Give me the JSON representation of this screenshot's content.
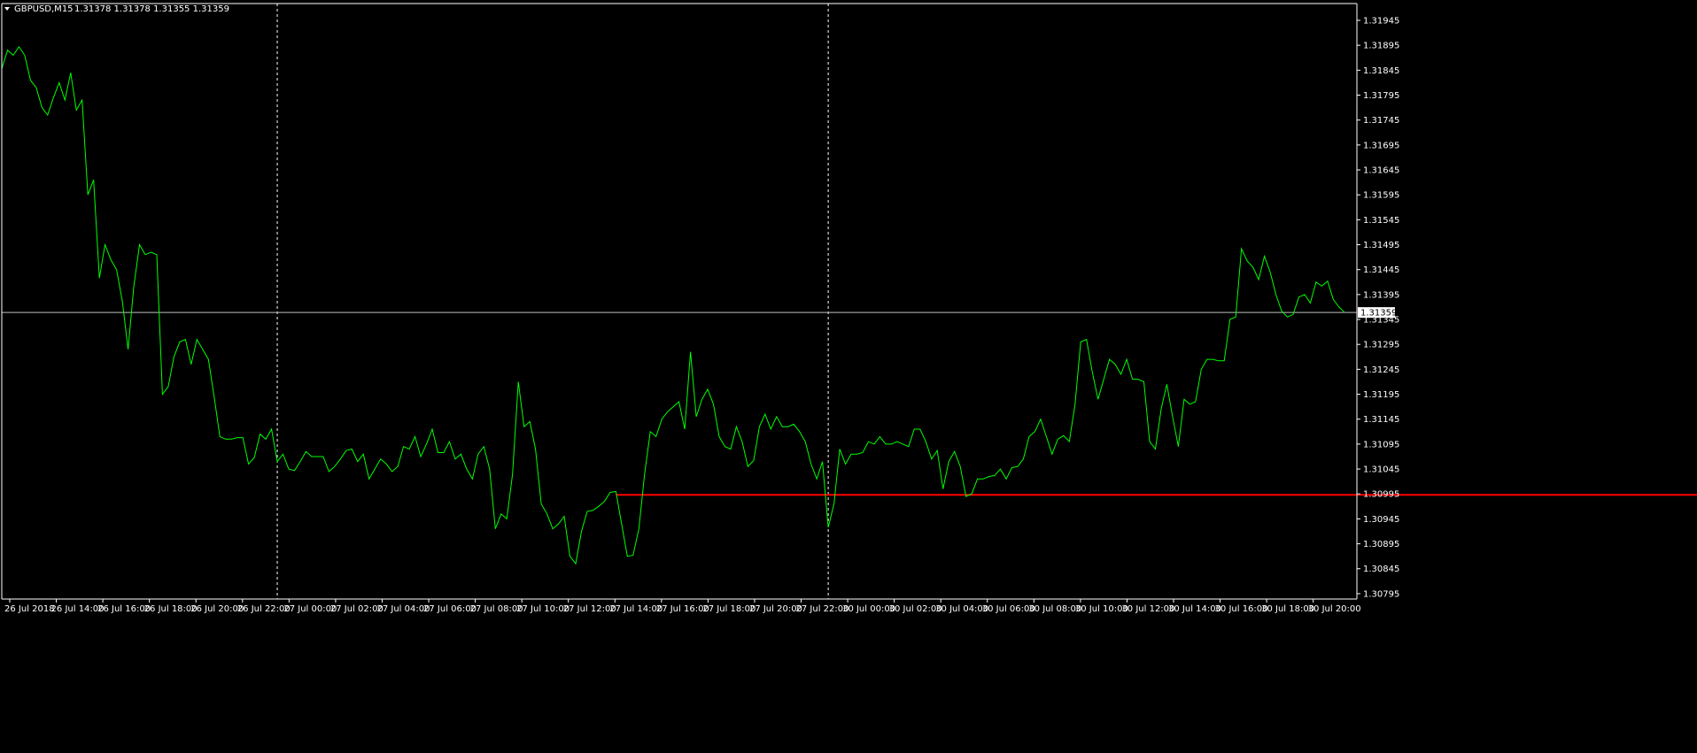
{
  "header": {
    "symbol": "GBPUSD,M15",
    "ohlc": "1.31378 1.31378 1.31355 1.31359",
    "menu_icon": "triangle-down-icon"
  },
  "current_price_label": "1.31359",
  "colors": {
    "background": "#000000",
    "price_line": "#00ff00",
    "axis": "#ffffff",
    "bid_line": "#c0c0c0",
    "level_line": "#ff0000",
    "separator": "#ffffff"
  },
  "chart_data": {
    "type": "line",
    "title": "",
    "xlabel": "",
    "ylabel": "",
    "ylim": [
      1.30775,
      1.31985
    ],
    "y_ticks": [
      "1.31945",
      "1.31895",
      "1.31845",
      "1.31795",
      "1.31745",
      "1.31695",
      "1.31645",
      "1.31595",
      "1.31545",
      "1.31495",
      "1.31445",
      "1.31395",
      "1.31345",
      "1.31295",
      "1.31245",
      "1.31195",
      "1.31145",
      "1.31095",
      "1.31045",
      "1.30995",
      "1.30945",
      "1.30895",
      "1.30845",
      "1.30795"
    ],
    "x_ticks": [
      "26 Jul 2018",
      "26 Jul 14:00",
      "26 Jul 16:00",
      "26 Jul 18:00",
      "26 Jul 20:00",
      "26 Jul 22:00",
      "27 Jul 00:00",
      "27 Jul 02:00",
      "27 Jul 04:00",
      "27 Jul 06:00",
      "27 Jul 08:00",
      "27 Jul 10:00",
      "27 Jul 12:00",
      "27 Jul 14:00",
      "27 Jul 16:00",
      "27 Jul 18:00",
      "27 Jul 20:00",
      "27 Jul 22:00",
      "30 Jul 00:00",
      "30 Jul 02:00",
      "30 Jul 04:00",
      "30 Jul 06:00",
      "30 Jul 08:00",
      "30 Jul 10:00",
      "30 Jul 12:00",
      "30 Jul 14:00",
      "30 Jul 16:00",
      "30 Jul 18:00",
      "30 Jul 20:00"
    ],
    "bars_start": "26 Jul 2018 12:00",
    "bar_period_minutes": 15,
    "day_separators": [
      "27 Jul 00:00",
      "30 Jul 00:00"
    ],
    "horizontal_levels": [
      1.30995
    ],
    "bid_level": 1.31359,
    "series": [
      {
        "values": [
          1.31848,
          1.31885,
          1.31875,
          1.31892,
          1.31875,
          1.31825,
          1.3181,
          1.3177,
          1.31755,
          1.3179,
          1.3182,
          1.31785,
          1.3184,
          1.31765,
          1.31785,
          1.31595,
          1.31625,
          1.31428,
          1.31495,
          1.31465,
          1.31445,
          1.31382,
          1.31285,
          1.3141,
          1.31495,
          1.31475,
          1.3148,
          1.31475,
          1.31195,
          1.3121,
          1.3127,
          1.313,
          1.31305,
          1.31255,
          1.31305,
          1.31285,
          1.31265,
          1.3119,
          1.3111,
          1.31105,
          1.31105,
          1.31108,
          1.31108,
          1.31055,
          1.31068,
          1.31115,
          1.31105,
          1.31125,
          1.3106,
          1.31075,
          1.31045,
          1.31042,
          1.3106,
          1.3108,
          1.3107,
          1.3107,
          1.3107,
          1.3104,
          1.3105,
          1.31065,
          1.31082,
          1.31085,
          1.3106,
          1.31075,
          1.31025,
          1.31045,
          1.31065,
          1.31055,
          1.3104,
          1.3105,
          1.3109,
          1.31085,
          1.3111,
          1.3107,
          1.31095,
          1.31125,
          1.31078,
          1.31078,
          1.311,
          1.31065,
          1.31075,
          1.31045,
          1.31025,
          1.31075,
          1.3109,
          1.31045,
          1.30925,
          1.30955,
          1.30945,
          1.31035,
          1.3122,
          1.3113,
          1.3114,
          1.31085,
          1.30975,
          1.30955,
          1.30925,
          1.30935,
          1.3095,
          1.3087,
          1.30855,
          1.3092,
          1.3096,
          1.30962,
          1.3097,
          1.3098,
          1.30998,
          1.31,
          1.30935,
          1.3087,
          1.30872,
          1.30925,
          1.31035,
          1.3112,
          1.3111,
          1.31145,
          1.3116,
          1.3117,
          1.3118,
          1.31125,
          1.3128,
          1.3115,
          1.31185,
          1.31205,
          1.31175,
          1.3111,
          1.3109,
          1.31085,
          1.3113,
          1.311,
          1.3105,
          1.31062,
          1.3113,
          1.31155,
          1.31125,
          1.3115,
          1.3113,
          1.3113,
          1.31135,
          1.3112,
          1.311,
          1.31055,
          1.31025,
          1.3106,
          1.30928,
          1.30975,
          1.31085,
          1.31055,
          1.31075,
          1.31075,
          1.31078,
          1.311,
          1.31095,
          1.3111,
          1.31095,
          1.31095,
          1.311,
          1.31095,
          1.3109,
          1.31125,
          1.31125,
          1.311,
          1.31065,
          1.31082,
          1.31005,
          1.3106,
          1.3108,
          1.3105,
          1.3099,
          1.30995,
          1.31025,
          1.31025,
          1.3103,
          1.31032,
          1.31045,
          1.31025,
          1.31048,
          1.3105,
          1.31065,
          1.3111,
          1.3112,
          1.31145,
          1.3111,
          1.31075,
          1.31105,
          1.31112,
          1.311,
          1.31175,
          1.313,
          1.31305,
          1.3124,
          1.31185,
          1.31225,
          1.31265,
          1.31255,
          1.31235,
          1.31265,
          1.31225,
          1.31225,
          1.3122,
          1.311,
          1.31085,
          1.31165,
          1.31215,
          1.3115,
          1.3109,
          1.31185,
          1.31175,
          1.3118,
          1.31245,
          1.31265,
          1.31265,
          1.31262,
          1.31262,
          1.31345,
          1.3135,
          1.31487,
          1.31462,
          1.3145,
          1.31425,
          1.31472,
          1.3144,
          1.31395,
          1.31362,
          1.3135,
          1.31355,
          1.3139,
          1.31395,
          1.31378,
          1.3142,
          1.31412,
          1.31422,
          1.31385,
          1.3137,
          1.31359
        ]
      }
    ]
  }
}
